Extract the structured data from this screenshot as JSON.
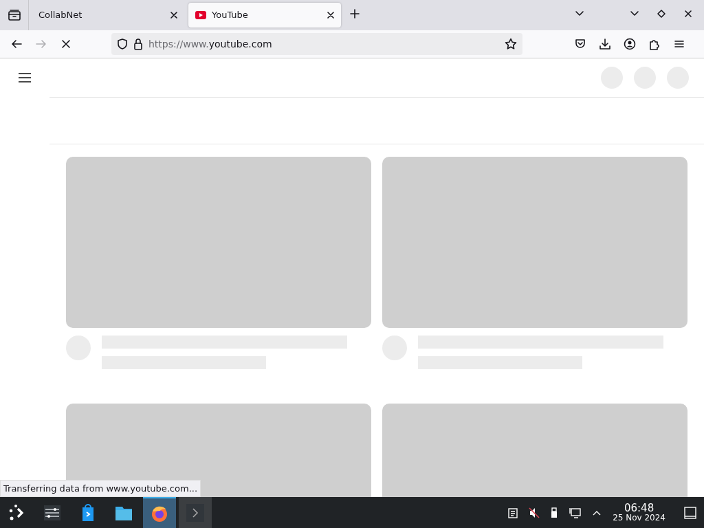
{
  "tabs": [
    {
      "label": "CollabNet",
      "selected": false,
      "favicon": false
    },
    {
      "label": "YouTube",
      "selected": true,
      "favicon": true
    }
  ],
  "toolbar": {
    "loading": true,
    "url_prefix": "https://www.",
    "url_host": "youtube.com"
  },
  "status_text": "Transferring data from www.youtube.com...",
  "taskbar": {
    "apps": [
      {
        "kind": "settings",
        "selected": false
      },
      {
        "kind": "store",
        "selected": false
      },
      {
        "kind": "files",
        "selected": false
      },
      {
        "kind": "browser",
        "selected": true
      },
      {
        "kind": "terminal",
        "selected": false
      }
    ],
    "muted": true,
    "time": "06:48",
    "date": "25 Nov 2024"
  }
}
